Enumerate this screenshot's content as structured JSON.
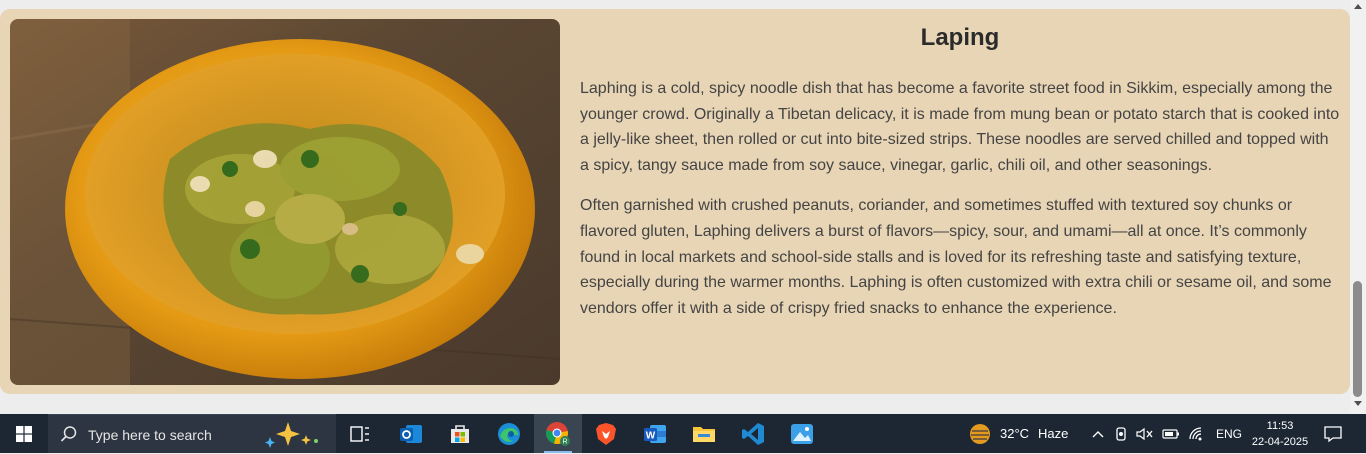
{
  "article": {
    "title": "Laping",
    "paragraphs": [
      "Laphing is a cold, spicy noodle dish that has become a favorite street food in Sikkim, especially among the younger crowd. Originally a Tibetan delicacy, it is made from mung bean or potato starch that is cooked into a jelly-like sheet, then rolled or cut into bite-sized strips. These noodles are served chilled and topped with a spicy, tangy sauce made from soy sauce, vinegar, garlic, chili oil, and other seasonings.",
      "Often garnished with crushed peanuts, coriander, and sometimes stuffed with textured soy chunks or flavored gluten, Laphing delivers a burst of flavors—spicy, sour, and umami—all at once. It’s commonly found in local markets and school-side stalls and is loved for its refreshing taste and satisfying texture, especially during the warmer months. Laphing is often customized with extra chili or sesame oil, and some vendors offer it with a side of crispy fried snacks to enhance the experience."
    ],
    "card_color": "#e8d5b5"
  },
  "taskbar": {
    "search_placeholder": "Type here to search",
    "apps": [
      {
        "icon": "task-view-icon"
      },
      {
        "icon": "outlook-icon"
      },
      {
        "icon": "microsoft-store-icon"
      },
      {
        "icon": "edge-icon"
      },
      {
        "icon": "chrome-icon",
        "active": true
      },
      {
        "icon": "brave-icon"
      },
      {
        "icon": "word-icon"
      },
      {
        "icon": "file-explorer-icon"
      },
      {
        "icon": "vscode-icon"
      },
      {
        "icon": "photos-icon"
      }
    ],
    "weather": {
      "temp": "32°C",
      "condition": "Haze"
    },
    "language": "ENG",
    "time": "11:53",
    "date": "22-04-2025"
  }
}
